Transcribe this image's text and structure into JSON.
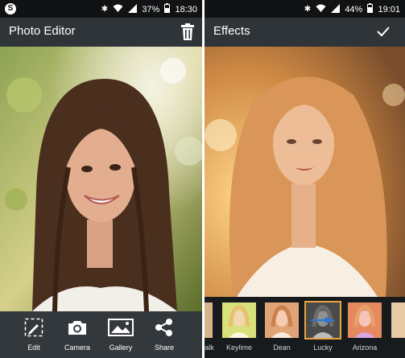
{
  "left_screen": {
    "status": {
      "battery": "37%",
      "time": "18:30"
    },
    "title": "Photo Editor",
    "toolbar": [
      {
        "label": "Edit",
        "icon": "edit-icon"
      },
      {
        "label": "Camera",
        "icon": "camera-icon"
      },
      {
        "label": "Gallery",
        "icon": "gallery-icon"
      },
      {
        "label": "Share",
        "icon": "share-icon"
      }
    ]
  },
  "right_screen": {
    "status": {
      "battery": "44%",
      "time": "19:01"
    },
    "title": "Effects",
    "effects": [
      {
        "label": "alk",
        "selected": false
      },
      {
        "label": "Keylime",
        "selected": false
      },
      {
        "label": "Dean",
        "selected": false
      },
      {
        "label": "Lucky",
        "selected": true
      },
      {
        "label": "Arizona",
        "selected": false
      }
    ]
  },
  "colors": {
    "appbar": "#2f3439",
    "statusbar": "#101214",
    "toolbar": "#33383d",
    "selected_accent": "#2a78d4"
  }
}
